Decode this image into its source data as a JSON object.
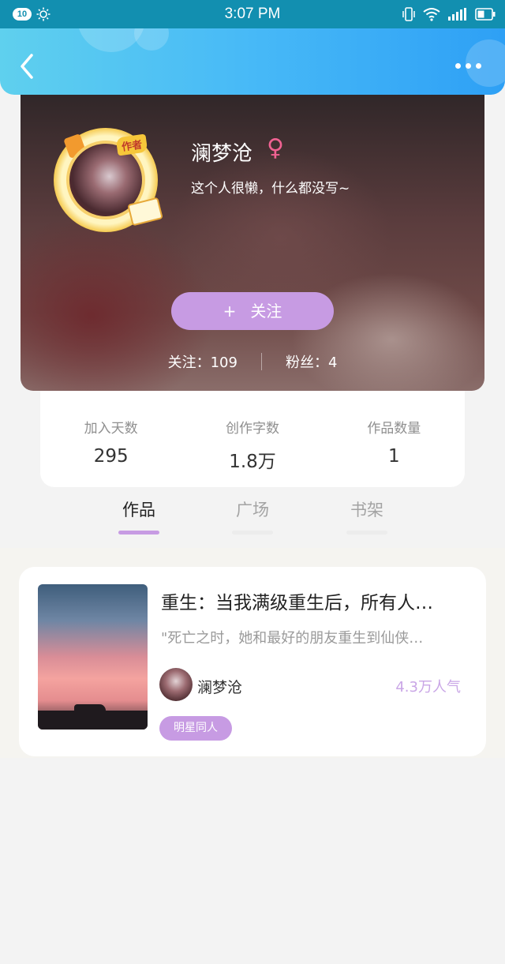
{
  "status_bar": {
    "notification_count": "10",
    "time": "3:07 PM"
  },
  "header": {
    "back": "back",
    "more": "more"
  },
  "profile": {
    "name": "澜梦沧",
    "gender_symbol": "♀",
    "bio": "这个人很懒，什么都没写~",
    "author_tag": "作者",
    "follow_plus": "+",
    "follow_label": "关注",
    "following_label": "关注：109",
    "fans_label": "粉丝：4"
  },
  "stats": [
    {
      "label": "加入天数",
      "value": "295"
    },
    {
      "label": "创作字数",
      "value": "1.8万"
    },
    {
      "label": "作品数量",
      "value": "1"
    }
  ],
  "tabs": [
    {
      "label": "作品",
      "active": true
    },
    {
      "label": "广场",
      "active": false
    },
    {
      "label": "书架",
      "active": false
    }
  ],
  "works": [
    {
      "title": "重生：当我满级重生后，所有人…",
      "description": "\"死亡之时，她和最好的朋友重生到仙侠…",
      "author": "澜梦沧",
      "popularity": "4.3万人气",
      "tag": "明星同人"
    }
  ],
  "colors": {
    "accent": "#c79be3",
    "header": "#47b9f7",
    "gender": "#f06292"
  }
}
